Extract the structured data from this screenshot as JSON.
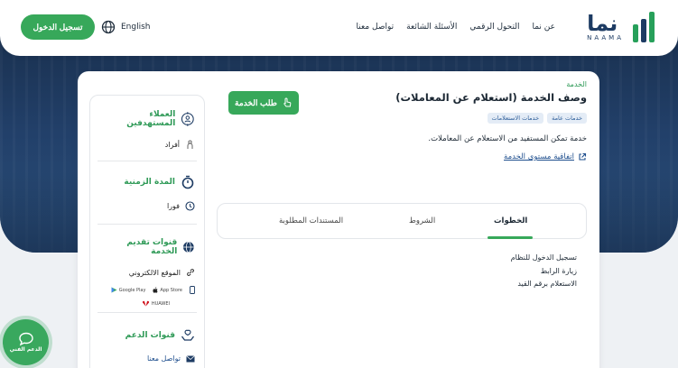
{
  "header": {
    "logo_ar": "نما",
    "logo_en": "NAAMA",
    "nav": [
      "عن نما",
      "التحول الرقمي",
      "الأسئلة الشائعة",
      "تواصل معنا"
    ],
    "language": "English",
    "login": "تسجيل الدخول"
  },
  "service": {
    "breadcrumb": "الخدمة",
    "title": "وصف الخدمة (استعلام عن المعاملات)",
    "tags": [
      "خدمات عامة",
      "خدمات الاستعلامات"
    ],
    "description": "خدمة تمكن المستفيد من الاستعلام عن المعاملات.",
    "sla": "اتفاقية مستوى الخدمة",
    "request_button": "طلب الخدمة"
  },
  "sidebar": {
    "beneficiaries_title": "العملاء المستهدفين",
    "beneficiaries_value": "أفراد",
    "duration_title": "المدة الزمنية",
    "duration_value": "فورا",
    "channels_title": "قنوات تقديم الخدمة",
    "channels_website": "الموقع الالكتروني",
    "store_google": "Google Play",
    "store_apple": "App Store",
    "store_huawei": "HUAWEI",
    "support_title": "قنوات الدعم",
    "support_contact": "تواصل معنا"
  },
  "tabs": {
    "steps": "الخطوات",
    "conditions": "الشروط",
    "documents": "المستندات المطلوبة"
  },
  "steps": [
    "تسجيل الدخول للنظام",
    "زيارة الرابط",
    "الاستعلام برقم القيد"
  ],
  "support_fab": "الدعم الفني",
  "colors": {
    "accent": "#37a85a",
    "navy": "#1d3b63"
  }
}
